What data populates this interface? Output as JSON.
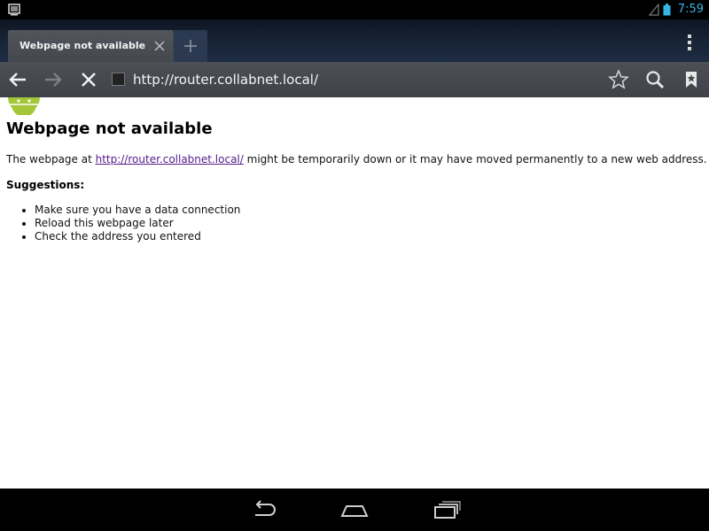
{
  "status_bar": {
    "time": "7:59",
    "icons": [
      "screenshot-icon",
      "signal-icon",
      "battery-icon"
    ],
    "time_color": "#33b5e5"
  },
  "tabs": [
    {
      "label": "Webpage not available",
      "active": true
    }
  ],
  "tab_actions": {
    "close_icon": "close-icon",
    "new_tab_icon": "plus-icon",
    "menu_icon": "overflow-menu-icon"
  },
  "toolbar": {
    "url": "http://router.collabnet.local/",
    "buttons": [
      "back-icon",
      "forward-icon",
      "stop-icon",
      "star-icon",
      "search-icon",
      "bookmarks-icon"
    ]
  },
  "page": {
    "title": "Webpage not available",
    "desc_before": "The webpage at ",
    "link": "http://router.collabnet.local/",
    "desc_after": " might be temporarily down or it may have moved permanently to a new web address.",
    "suggestions_heading": "Suggestions:",
    "suggestions": [
      "Make sure you have a data connection",
      "Reload this webpage later",
      "Check the address you entered"
    ],
    "link_color": "#551a8b"
  },
  "nav_bar": {
    "buttons": [
      "back-nav-icon",
      "home-icon",
      "recent-apps-icon"
    ]
  }
}
